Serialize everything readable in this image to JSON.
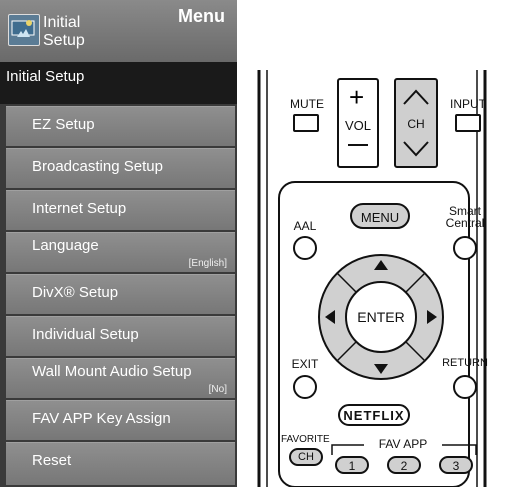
{
  "menu": {
    "header_title_line1": "Initial",
    "header_title_line2": "Setup",
    "header_menu_label": "Menu",
    "section_title": "Initial Setup",
    "items": [
      {
        "label": "EZ Setup",
        "value": ""
      },
      {
        "label": "Broadcasting Setup",
        "value": ""
      },
      {
        "label": "Internet Setup",
        "value": ""
      },
      {
        "label": "Language",
        "value": "[English]"
      },
      {
        "label": "DivX® Setup",
        "value": ""
      },
      {
        "label": "Individual Setup",
        "value": ""
      },
      {
        "label": "Wall Mount Audio Setup",
        "value": "[No]"
      },
      {
        "label": "FAV APP Key Assign",
        "value": ""
      },
      {
        "label": "Reset",
        "value": ""
      }
    ]
  },
  "remote": {
    "mute": "MUTE",
    "vol": "VOL",
    "ch": "CH",
    "input": "INPUT",
    "aal": "AAL",
    "menu": "MENU",
    "smart_central_line1": "Smart",
    "smart_central_line2": "Central",
    "enter": "ENTER",
    "exit": "EXIT",
    "return": "RETURN",
    "netflix": "NETFLIX",
    "favorite": "FAVORITE",
    "favorite_ch": "CH",
    "fav_app": "FAV APP",
    "fav_buttons": [
      "1",
      "2",
      "3"
    ]
  }
}
